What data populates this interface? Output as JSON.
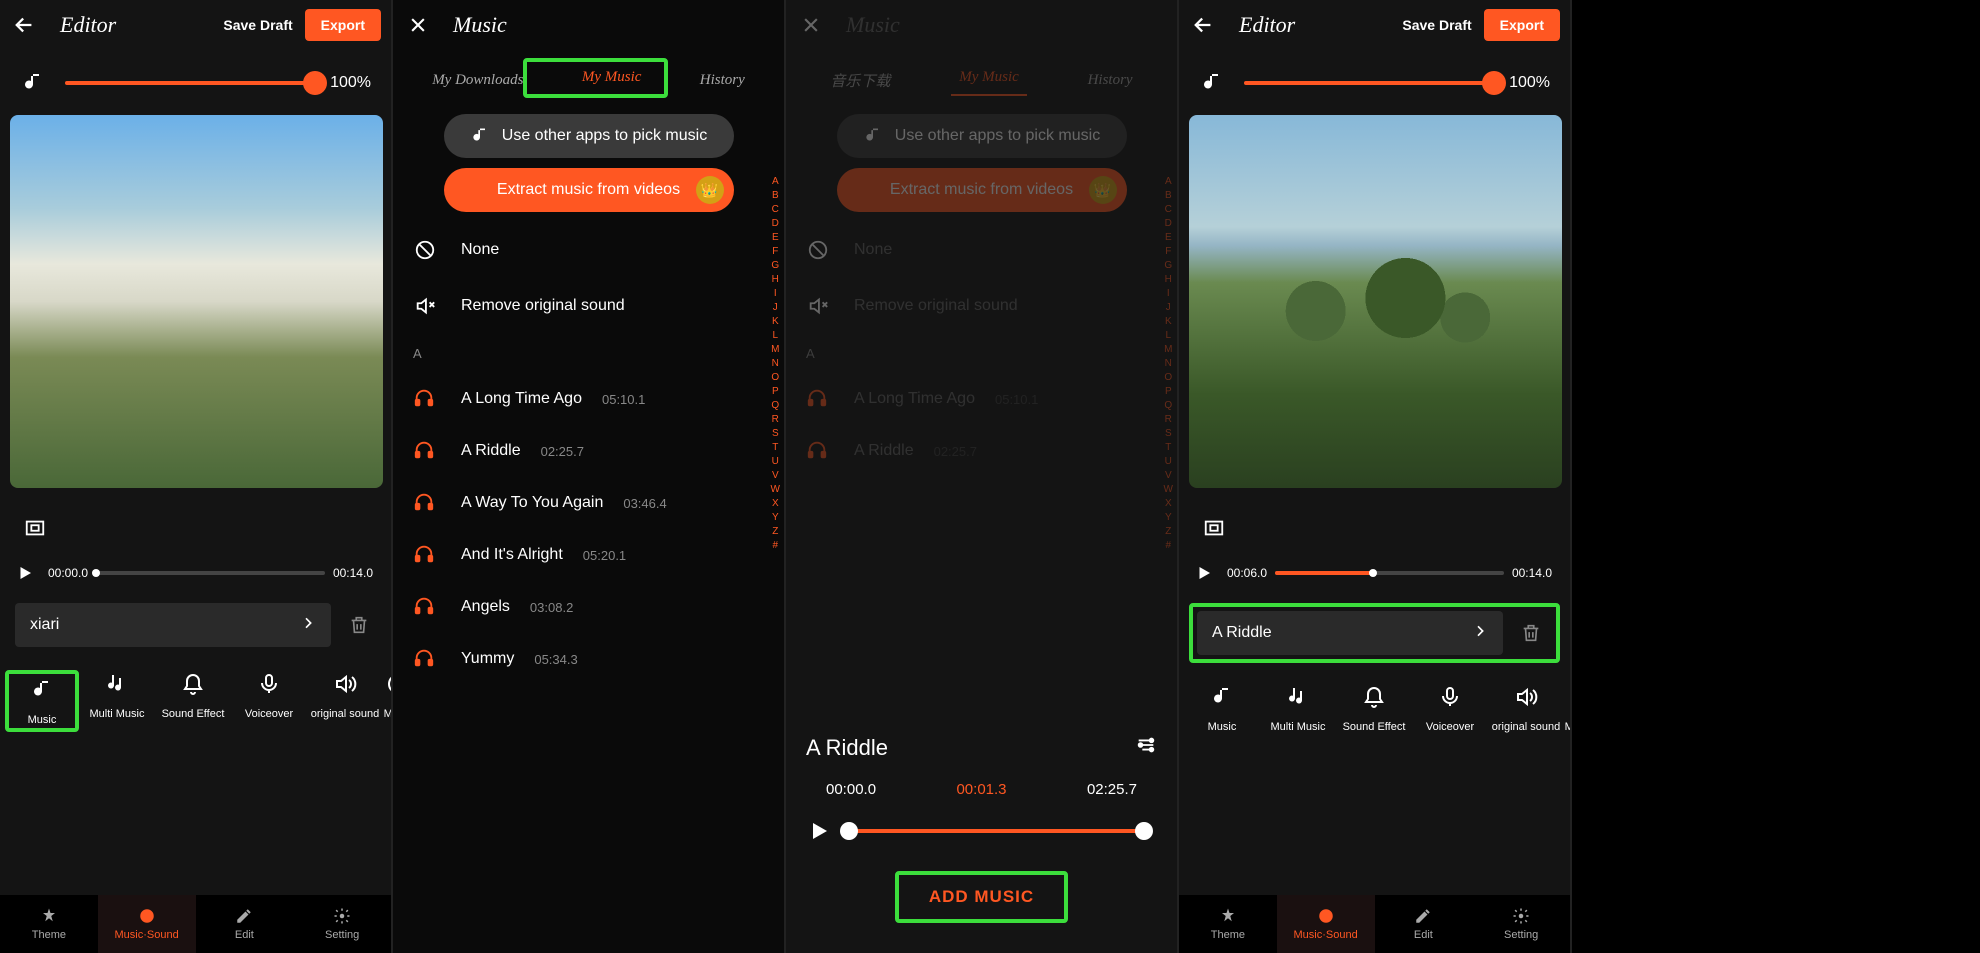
{
  "editor": {
    "title": "Editor",
    "save_draft": "Save Draft",
    "export": "Export",
    "volume_pct": "100%",
    "timeline": {
      "start": "00:00.0",
      "end": "00:14.0",
      "start2": "00:06.0"
    },
    "clip1": "xiari",
    "clip2": "A Riddle",
    "sound_tabs": [
      {
        "label": "Music"
      },
      {
        "label": "Multi Music"
      },
      {
        "label": "Sound Effect"
      },
      {
        "label": "Voiceover"
      },
      {
        "label": "original sound"
      },
      {
        "label": "Music"
      }
    ],
    "nav": [
      {
        "label": "Theme"
      },
      {
        "label": "Music·Sound"
      },
      {
        "label": "Edit"
      },
      {
        "label": "Setting"
      }
    ]
  },
  "music": {
    "title": "Music",
    "tabs": {
      "downloads": "My Downloads",
      "downloads_cn": "音乐下载",
      "mymusic": "My Music",
      "history": "History"
    },
    "pick_other": "Use other apps to pick music",
    "extract": "Extract music from videos",
    "none": "None",
    "remove_orig": "Remove original sound",
    "section_a": "A",
    "songs": [
      {
        "title": "A Long Time Ago",
        "dur": "05:10.1"
      },
      {
        "title": "A Riddle",
        "dur": "02:25.7"
      },
      {
        "title": "A Way To You Again",
        "dur": "03:46.4"
      },
      {
        "title": "And It's Alright",
        "dur": "05:20.1"
      },
      {
        "title": "Angels",
        "dur": "03:08.2"
      },
      {
        "title": "Yummy",
        "dur": "05:34.3"
      }
    ],
    "alpha": [
      "A",
      "B",
      "C",
      "D",
      "E",
      "F",
      "G",
      "H",
      "I",
      "J",
      "K",
      "L",
      "M",
      "N",
      "O",
      "P",
      "Q",
      "R",
      "S",
      "T",
      "U",
      "V",
      "W",
      "X",
      "Y",
      "Z",
      "#"
    ]
  },
  "player": {
    "title": "A Riddle",
    "t_start": "00:00.0",
    "t_cur": "00:01.3",
    "t_end": "02:25.7",
    "add": "ADD MUSIC"
  }
}
